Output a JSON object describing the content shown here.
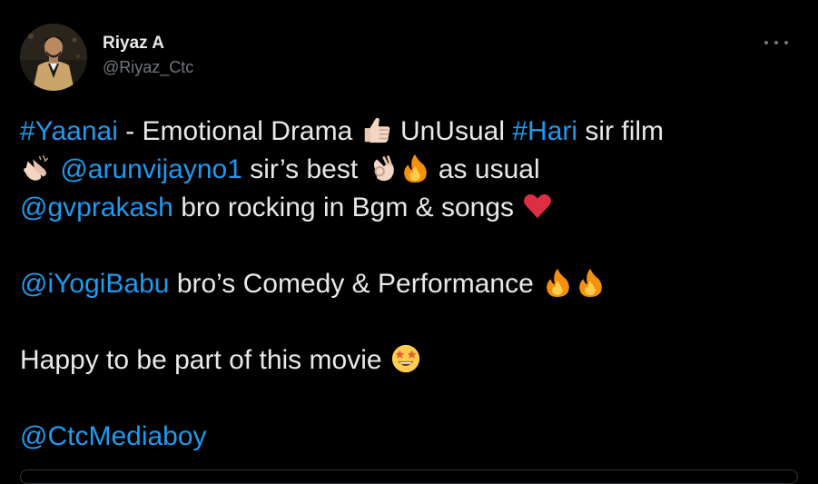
{
  "author": {
    "display_name": "Riyaz A",
    "handle": "@Riyaz_Ctc"
  },
  "more_menu": {
    "icon": "more-horizontal-icon"
  },
  "tweet": {
    "line1": {
      "hashtag_yaanai": "#Yaanai",
      "text_a": " - Emotional Drama ",
      "emoji_thumbs": "thumbs-up",
      "text_b": " UnUsual ",
      "hashtag_hari": "#Hari",
      "text_c": " sir film"
    },
    "line2": {
      "emoji_clap": "clapping-hands",
      "mention_arun": "@arunvijayno1",
      "text_a": " sir’s best ",
      "emoji_ok": "ok-hand",
      "emoji_fire": "fire",
      "text_b": " as usual"
    },
    "line3": {
      "mention_gv": "@gvprakash",
      "text_a": " bro rocking in Bgm & songs ",
      "emoji_heart": "red-heart"
    },
    "line4": {
      "mention_yogi": "@iYogiBabu",
      "text_a": " bro’s Comedy & Performance ",
      "emoji_fire1": "fire",
      "emoji_fire2": "fire"
    },
    "line5": {
      "text_a": "Happy to be part of this movie ",
      "emoji_star": "star-struck"
    },
    "line6": {
      "mention_ctc": "@CtcMediaboy"
    }
  },
  "colors": {
    "background": "#000000",
    "text": "#e7e9ea",
    "secondary": "#71767b",
    "link": "#1d9bf0"
  }
}
